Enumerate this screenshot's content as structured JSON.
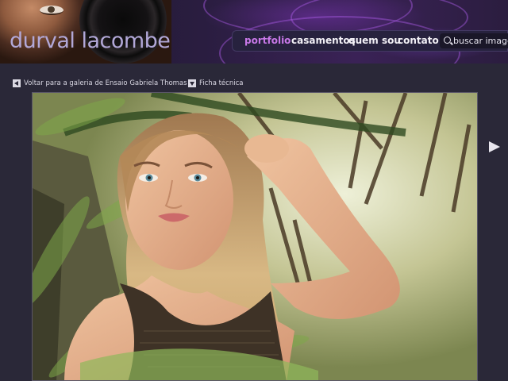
{
  "brand": {
    "logo_text": "durval lacombe"
  },
  "nav": {
    "items": [
      {
        "label": "portfolio",
        "active": true
      },
      {
        "label": "casamentos",
        "active": false
      },
      {
        "label": "quem sou",
        "active": false
      },
      {
        "label": "contato",
        "active": false
      }
    ],
    "search_placeholder": "buscar imagens"
  },
  "subnav": {
    "back_label": "Voltar para a galeria de Ensaio Gabriela Thomas",
    "specs_label": "Ficha técnica"
  },
  "colors": {
    "background": "#2a2838",
    "nav_active": "#c878e8",
    "nav_text": "#f2f0f6",
    "logo_text": "#b2a8d8"
  },
  "icons": {
    "back": "triangle-left-icon",
    "specs": "triangle-down-icon",
    "next": "triangle-right-icon",
    "search": "magnifier-icon"
  }
}
